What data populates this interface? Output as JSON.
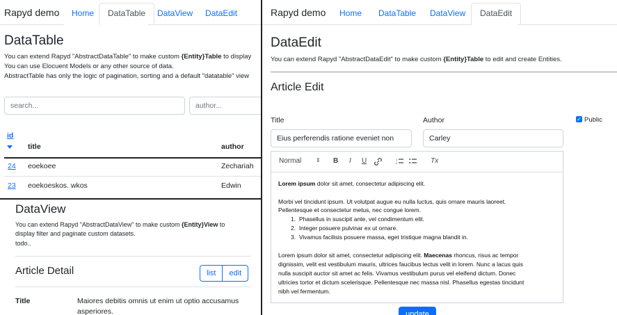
{
  "left_top": {
    "brand": "Rapyd demo",
    "tabs": [
      "Home",
      "DataTable",
      "DataView",
      "DataEdit"
    ],
    "active_tab": "DataTable",
    "title": "DataTable",
    "desc_1_pre": "You can extend Rapyd \"AbstractDataTable\" to make custom ",
    "desc_1_bold": "{Entity}Table",
    "desc_1_post": " to display",
    "desc_2": "You can use Elocuent Models or any other source of data.",
    "desc_3": "AbstractTable has only the logic of pagination, sorting and a default \"datatable\" view",
    "search_placeholder": "search...",
    "author_placeholder": "author...",
    "columns": {
      "id": "id",
      "title": "title",
      "author": "author"
    },
    "sort_icon": "caret-down-icon",
    "rows": [
      {
        "id": "24",
        "title": "eoekoee",
        "author": "Zechariah"
      },
      {
        "id": "23",
        "title": "eoekoeskos. wkos",
        "author": "Edwin"
      }
    ]
  },
  "left_bottom": {
    "title": "DataView",
    "desc_1_pre": "You can extend Rapyd \"AbstractDataView\" to make custom ",
    "desc_1_bold": "{Entity}View",
    "desc_1_post": " to",
    "desc_2": "display filter and paginate custom datasets.",
    "desc_3": "todo..",
    "card_title": "Article Detail",
    "btn_list": "list",
    "btn_edit": "edit",
    "field_label": "Title",
    "field_value_1": "Maiores debitis omnis ut enim ut optio accusamus",
    "field_value_2": "asperiores."
  },
  "right": {
    "brand": "Rapyd demo",
    "tabs": [
      "Home",
      "DataTable",
      "DataView",
      "DataEdit"
    ],
    "active_tab": "DataEdit",
    "title": "DataEdit",
    "desc_pre": "You can extend Rapyd \"AbstractDataEdit\" to make custom ",
    "desc_bold": "{Entity}Table",
    "desc_post": " to edit and create Entities.",
    "form_title": "Article Edit",
    "label_title": "Title",
    "label_author": "Author",
    "label_public": "Public",
    "title_value": "Eius perferendis ratione eveniet non",
    "author_value": "Carley",
    "toolbar": {
      "format": "Normal",
      "bold": "B",
      "italic": "I",
      "underline": "U",
      "clear": "Tx"
    },
    "editor": {
      "p1_bold": "Lorem ipsum",
      "p1_rest": " dolor sit amet, consectetur adipiscing elit.",
      "p2_l1": "Morbi vel tincidunt ipsum. Ut volutpat augue eu nulla luctus, quis ornare mauris laoreet.",
      "p2_l2": "Pellentesque et consectetur metus, nec congue lorem.",
      "list": [
        "Phasellus in suscipit ante, vel condimentum elit.",
        "Integer posuere pulvinar ex ut ornare.",
        "Vivamus facilisis posuere massa, eget tristique magna blandit in."
      ],
      "p3_l1_pre": "Lorem ipsum dolor sit amet, consectetur adipiscing elit. ",
      "p3_l1_bold": "Maecenas",
      "p3_l1_post": " rhoncus, risus ac tempor",
      "p3_l2": "dignissim, velit est vestibulum mauris, ultrices faucibus lectus velit in lorem. Nunc a lacus quis",
      "p3_l3": "nulla suscipit auctor sit amet ac felis. Vivamus vestibulum purus vel eleifend dictum. Donec",
      "p3_l4": "ultricies tortor et dictum scelerisque. Pellentesque nec massa nisl. Phasellus egestas tincidunt",
      "p3_l5": "nibh vel fermentum."
    },
    "submit_label": "update"
  },
  "colors": {
    "accent": "#0d6efd",
    "divider": "#222222"
  }
}
